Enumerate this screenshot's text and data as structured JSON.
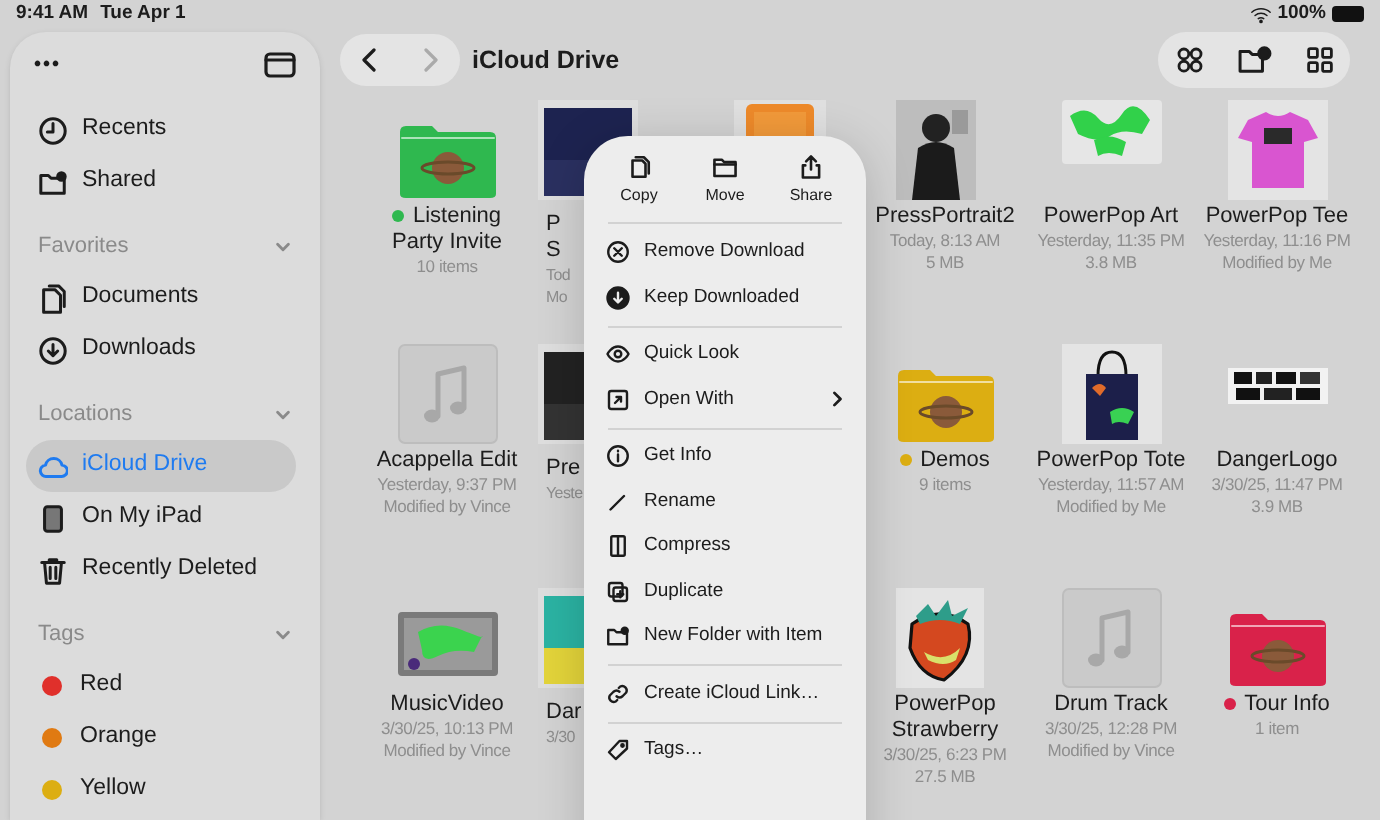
{
  "status_bar": {
    "time": "9:41 AM",
    "date": "Tue Apr 1",
    "battery": "100%"
  },
  "sidebar": {
    "more_button": "•••",
    "items": [
      {
        "label": "Recents",
        "selected": false
      },
      {
        "label": "Shared",
        "selected": false
      }
    ],
    "sections": [
      {
        "title": "Favorites",
        "expanded": true,
        "items": [
          {
            "label": "Documents",
            "selected": false
          },
          {
            "label": "Downloads",
            "selected": false
          }
        ]
      },
      {
        "title": "Locations",
        "expanded": true,
        "items": [
          {
            "label": "iCloud Drive",
            "selected": true
          },
          {
            "label": "On My iPad",
            "selected": false
          },
          {
            "label": "Recently Deleted",
            "selected": false
          }
        ]
      },
      {
        "title": "Tags",
        "expanded": true,
        "items": [
          {
            "label": "Red",
            "selected": false,
            "color": "#e0302b"
          },
          {
            "label": "Orange",
            "selected": false,
            "color": "#e07a12"
          },
          {
            "label": "Yellow",
            "selected": false,
            "color": "#dcae12"
          }
        ]
      }
    ]
  },
  "toolbar": {
    "title": "iCloud Drive",
    "back_disabled": false,
    "forward_disabled": true
  },
  "files": [
    [
      {
        "kind": "folder",
        "name": "Listening Party Invite",
        "color": "#2fb84f",
        "meta": [
          "10 items"
        ]
      },
      {
        "kind": "partial",
        "name_lines": [
          "P",
          "S"
        ],
        "meta": [
          "Tod",
          "Mo"
        ]
      },
      {
        "kind": "picture"
      },
      {
        "name": "PressPortrait2",
        "meta": [
          "Today, 8:13 AM",
          "5 MB"
        ]
      },
      {
        "name": "PowerPop Art",
        "meta": [
          "Yesterday, 11:35 PM",
          "3.8 MB"
        ]
      },
      {
        "name": "PowerPop Tee",
        "meta": [
          "Yesterday, 11:16 PM",
          "Modified by Me"
        ]
      }
    ],
    [
      {
        "kind": "audio",
        "name": "Acappella Edit",
        "meta": [
          "Yesterday, 9:37 PM",
          "Modified by Vince"
        ]
      },
      {
        "kind": "partial",
        "name_lines": [
          "Pre"
        ],
        "meta": [
          "Yeste"
        ]
      },
      {
        "kind": "folder",
        "name": "Demos",
        "color": "#dcae12",
        "meta": [
          "9 items"
        ]
      },
      {
        "name": "PowerPop Tote",
        "meta": [
          "Yesterday, 11:57 AM",
          "Modified by Me"
        ]
      },
      {
        "name": "DangerLogo",
        "meta": [
          "3/30/25, 11:47 PM",
          "3.9 MB"
        ]
      }
    ],
    [
      {
        "name": "MusicVideo",
        "meta": [
          "3/30/25, 10:13 PM",
          "Modified by Vince"
        ]
      },
      {
        "kind": "partial",
        "name_lines": [
          "Dar"
        ],
        "meta": [
          "3/30"
        ]
      },
      {
        "name": "PowerPop Strawberry",
        "meta": [
          "3/30/25, 6:23 PM",
          "27.5 MB"
        ]
      },
      {
        "kind": "audio",
        "name": "Drum Track",
        "meta": [
          "3/30/25, 12:28 PM",
          "Modified by Vince"
        ]
      },
      {
        "kind": "folder",
        "name": "Tour Info",
        "color": "#d9224a",
        "meta": [
          "1 item"
        ]
      }
    ]
  ],
  "context_menu": {
    "actions": [
      {
        "label": "Copy"
      },
      {
        "label": "Move"
      },
      {
        "label": "Share"
      }
    ],
    "groups": [
      [
        {
          "label": "Remove Download",
          "submenu": false
        },
        {
          "label": "Keep Downloaded",
          "submenu": false
        }
      ],
      [
        {
          "label": "Quick Look",
          "submenu": false
        },
        {
          "label": "Open With",
          "submenu": true
        }
      ],
      [
        {
          "label": "Get Info",
          "submenu": false
        },
        {
          "label": "Rename",
          "submenu": false
        },
        {
          "label": "Compress",
          "submenu": false
        },
        {
          "label": "Duplicate",
          "submenu": false
        },
        {
          "label": "New Folder with Item",
          "submenu": false
        }
      ],
      [
        {
          "label": "Create iCloud Link…",
          "submenu": false
        }
      ],
      [
        {
          "label": "Tags…",
          "submenu": false
        }
      ]
    ]
  }
}
